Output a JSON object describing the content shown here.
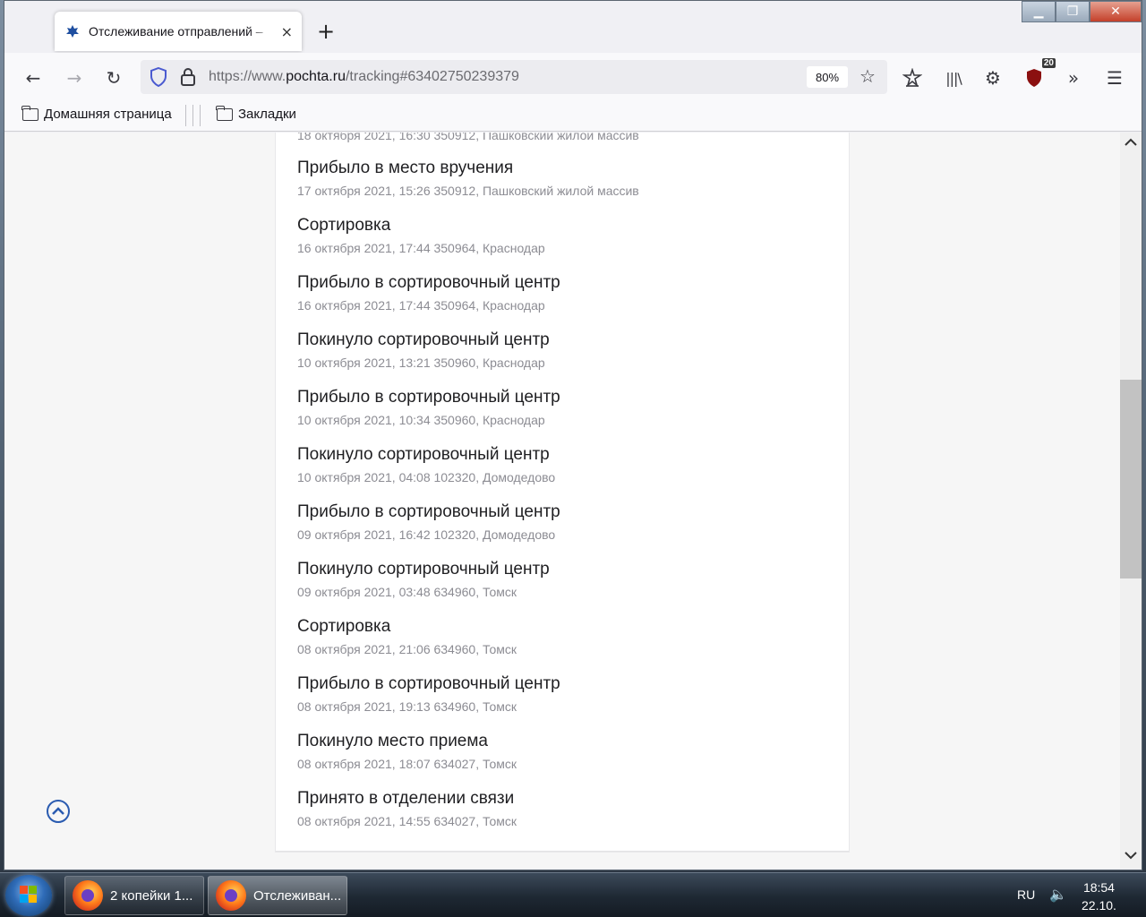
{
  "browser": {
    "tab": {
      "title": "Отслеживание отправлений –",
      "close": "×"
    },
    "new_tab": "+",
    "window_controls": {
      "minimize": "▁",
      "maximize": "❐",
      "close": "✕"
    },
    "nav": {
      "back": "←",
      "forward": "→",
      "reload": "↻"
    },
    "url": {
      "prefix": "https://www.",
      "host": "pochta.ru",
      "path": "/tracking#63402750239379"
    },
    "zoom": "80%",
    "toolbar": {
      "ublock_count": "20"
    },
    "bookmarks": [
      {
        "label": "Домашняя страница"
      },
      {
        "label": "Закладки"
      }
    ]
  },
  "tracking": {
    "partial_top_meta": "18 октября 2021, 16:30 350912, Пашковский жилой массив",
    "events": [
      {
        "title": "Прибыло в место вручения",
        "meta": "17 октября 2021, 15:26 350912, Пашковский жилой массив"
      },
      {
        "title": "Сортировка",
        "meta": "16 октября 2021, 17:44 350964, Краснодар"
      },
      {
        "title": "Прибыло в сортировочный центр",
        "meta": "16 октября 2021, 17:44 350964, Краснодар"
      },
      {
        "title": "Покинуло сортировочный центр",
        "meta": "10 октября 2021, 13:21 350960, Краснодар"
      },
      {
        "title": "Прибыло в сортировочный центр",
        "meta": "10 октября 2021, 10:34 350960, Краснодар"
      },
      {
        "title": "Покинуло сортировочный центр",
        "meta": "10 октября 2021, 04:08 102320, Домодедово"
      },
      {
        "title": "Прибыло в сортировочный центр",
        "meta": "09 октября 2021, 16:42 102320, Домодедово"
      },
      {
        "title": "Покинуло сортировочный центр",
        "meta": "09 октября 2021, 03:48 634960, Томск"
      },
      {
        "title": "Сортировка",
        "meta": "08 октября 2021, 21:06 634960, Томск"
      },
      {
        "title": "Прибыло в сортировочный центр",
        "meta": "08 октября 2021, 19:13 634960, Томск"
      },
      {
        "title": "Покинуло место приема",
        "meta": "08 октября 2021, 18:07 634027, Томск"
      },
      {
        "title": "Принято в отделении связи",
        "meta": "08 октября 2021, 14:55 634027, Томск"
      }
    ]
  },
  "taskbar": {
    "items": [
      {
        "label": "2 копейки 1..."
      },
      {
        "label": "Отслеживан..."
      }
    ],
    "lang": "RU",
    "time": "18:54",
    "date": "22.10."
  },
  "colors": {
    "accent": "#2a5bb0",
    "meta_text": "#8c8c93"
  }
}
